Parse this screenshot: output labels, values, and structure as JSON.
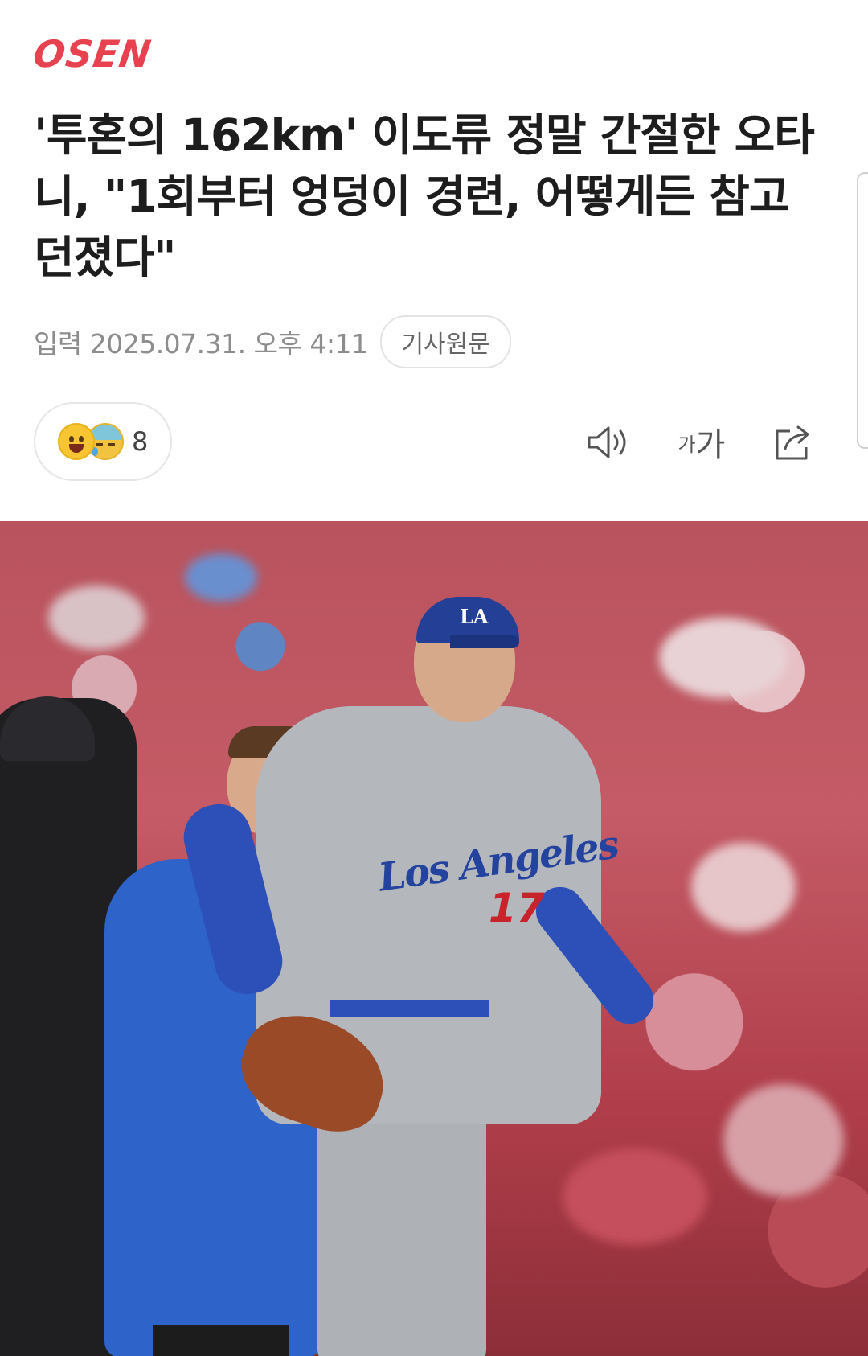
{
  "brand": {
    "logo_text": "OSEN",
    "accent": "#e8414f"
  },
  "article": {
    "headline": "'투혼의 162km' 이도류 정말 간절한 오타니, \"1회부터 엉덩이 경련, 어떻게든 참고 던졌다\"",
    "published": "입력 2025.07.31. 오후 4:11",
    "origin_button": "기사원문"
  },
  "reactions": {
    "icons": [
      "smile-emoji-icon",
      "sad-sweat-emoji-icon"
    ],
    "count": "8"
  },
  "toolbar": {
    "audio_icon": "speaker-icon",
    "font_size_small": "가",
    "font_size_big": "가",
    "share_icon": "share-icon"
  },
  "photo": {
    "jersey_script": "Los Angeles",
    "jersey_number": "17",
    "cap_logo": "LA"
  }
}
